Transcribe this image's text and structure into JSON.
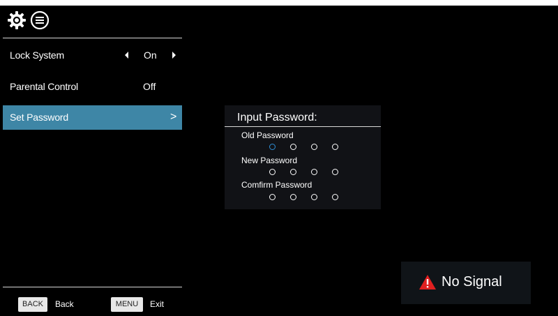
{
  "top_icons": {
    "settings_icon": "gear-icon",
    "menu_icon": "list-icon"
  },
  "menu": {
    "items": [
      {
        "label": "Lock System",
        "value": "On"
      },
      {
        "label": "Parental Control",
        "value": "Off"
      },
      {
        "label": "Set Password",
        "value": ">"
      }
    ]
  },
  "footer": {
    "back_key": "BACK",
    "back_label": "Back",
    "menu_key": "MENU",
    "menu_label": "Exit"
  },
  "password_dialog": {
    "title": "Input Password:",
    "fields": [
      {
        "label": "Old Password"
      },
      {
        "label": "New Password"
      },
      {
        "label": "Comfirm Password"
      }
    ],
    "accent": "#2f8fd6"
  },
  "status": {
    "no_signal": "No Signal",
    "warning_color": "#e02020"
  },
  "colors": {
    "selected_row": "#3e86a6",
    "background": "#000000"
  }
}
